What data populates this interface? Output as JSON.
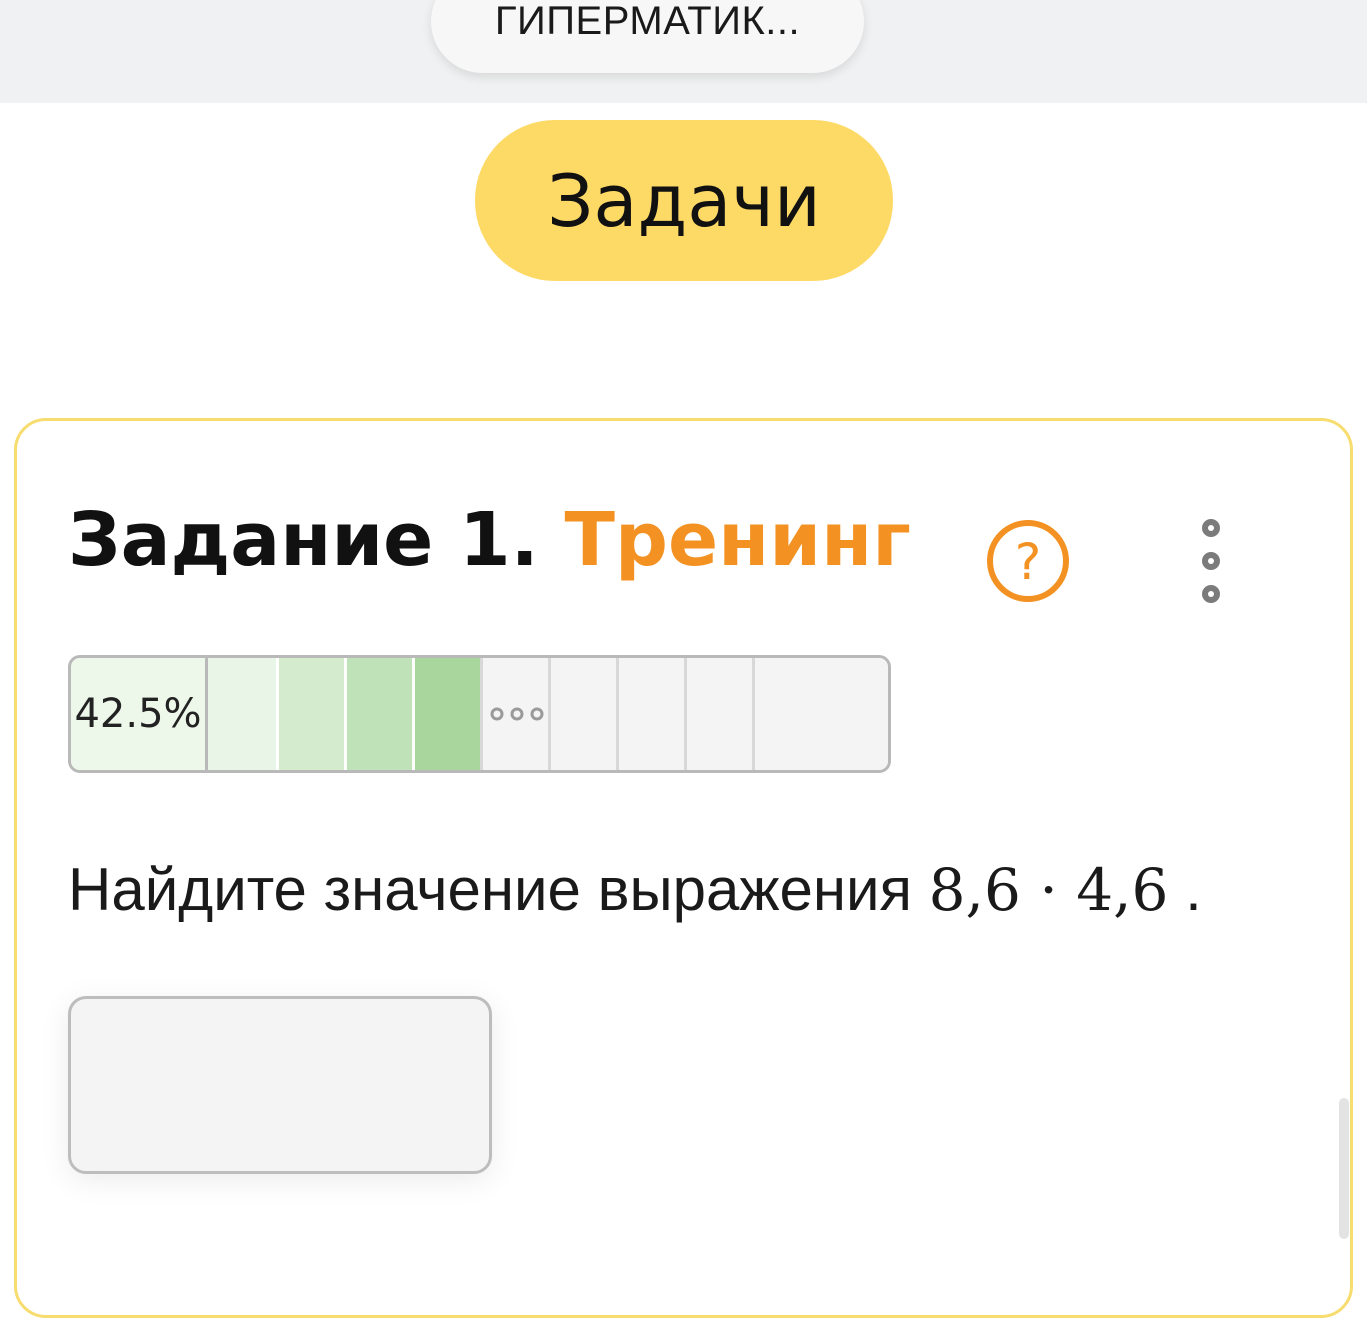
{
  "header": {
    "title": "ГИПЕРМАТИК..."
  },
  "nav": {
    "tasks_button": "Задачи"
  },
  "task": {
    "title": "Задание 1.",
    "mode": "Тренинг",
    "help_icon": "question-circle-icon",
    "menu_icon": "vertical-dots-icon",
    "progress": {
      "percent_label": "42.5%",
      "percent": 42.5,
      "segments": [
        {
          "state": "done",
          "shade": "#e9f5e6"
        },
        {
          "state": "done",
          "shade": "#d4ebce"
        },
        {
          "state": "done",
          "shade": "#c0e2b8"
        },
        {
          "state": "done",
          "shade": "#a9d69d"
        },
        {
          "state": "more",
          "icon": "ellipsis-icon"
        },
        {
          "state": "empty"
        },
        {
          "state": "empty"
        },
        {
          "state": "empty"
        },
        {
          "state": "empty"
        },
        {
          "state": "empty"
        }
      ]
    },
    "question_text": "Найдите значение выражения",
    "question_math": "8,6 · 4,6",
    "question_end": ".",
    "answer": {
      "value": "",
      "placeholder": ""
    }
  },
  "colors": {
    "accent": "#f39223",
    "button_yellow": "#fdd965",
    "card_border": "#f7dc6f"
  }
}
